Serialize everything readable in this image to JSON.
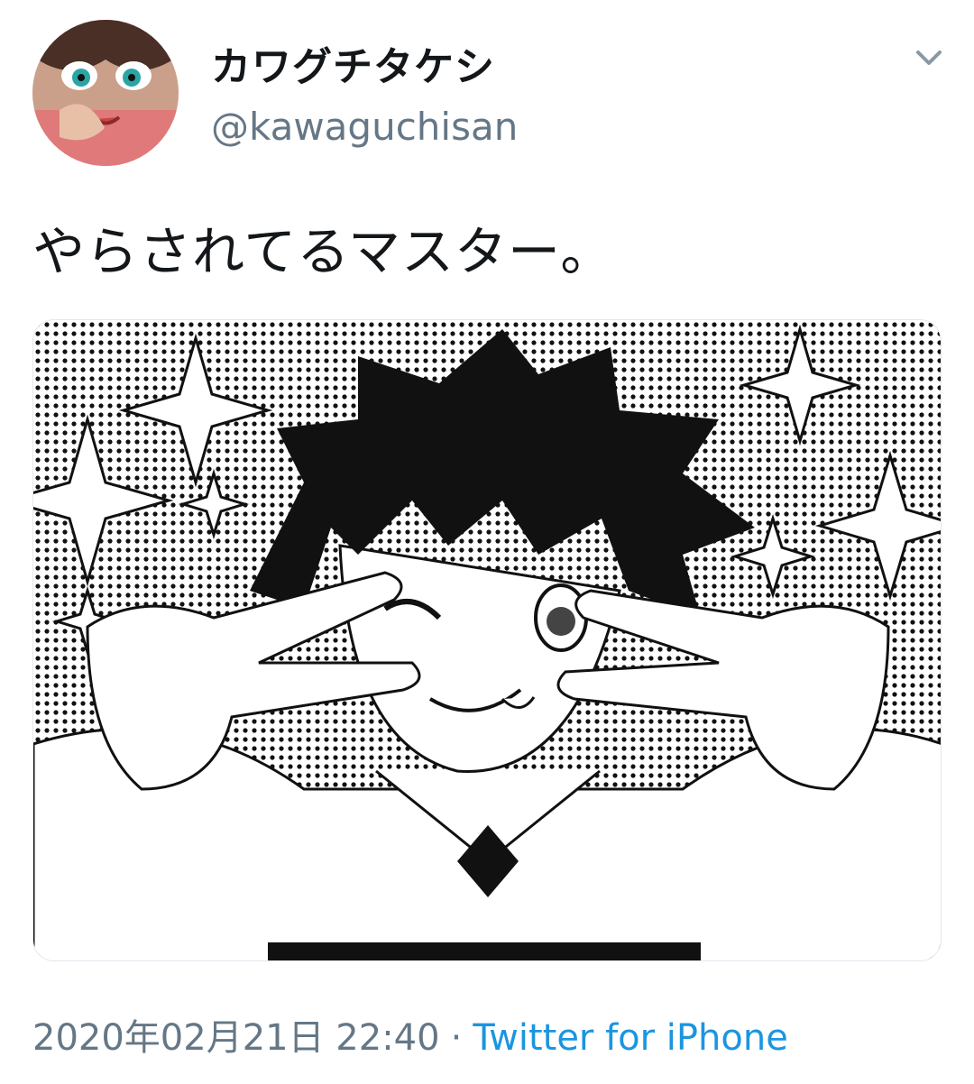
{
  "tweet": {
    "display_name": "カワグチタケシ",
    "handle": "@kawaguchisan",
    "text": "やらされてるマスター。",
    "timestamp": "2020年02月21日 22:40",
    "separator": "·",
    "source": "Twitter for iPhone"
  },
  "icons": {
    "caret": "chevron-down-icon",
    "avatar": "user-avatar"
  },
  "colors": {
    "name": "#14171a",
    "secondary": "#657786",
    "link": "#1b95e0"
  }
}
